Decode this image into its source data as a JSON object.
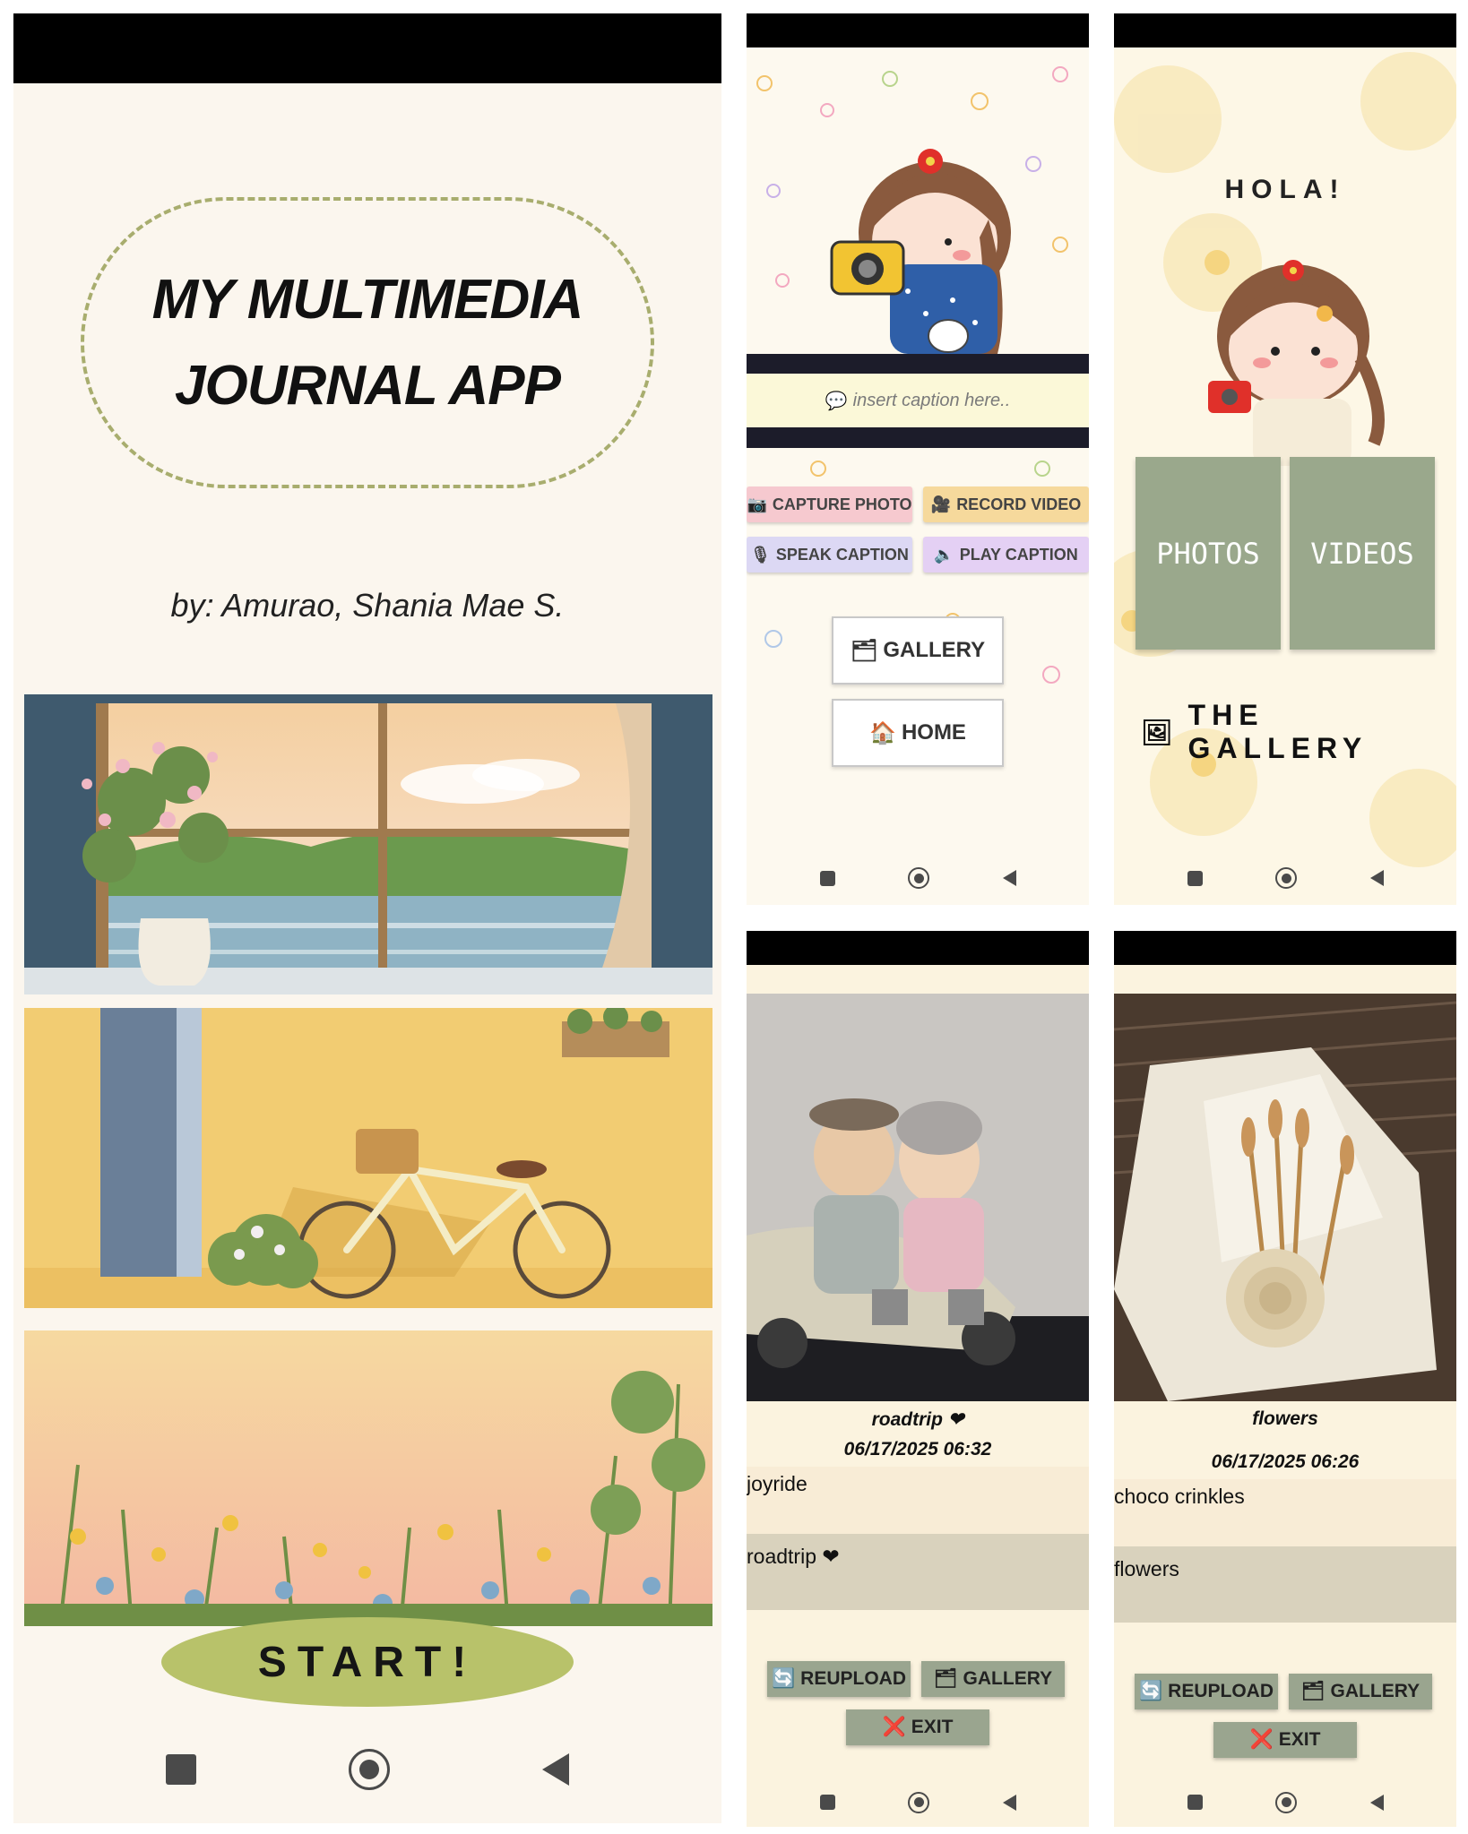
{
  "splash": {
    "title_line1": "MY MULTIMEDIA",
    "title_line2": "JOURNAL APP",
    "author": "by: Amurao, Shania Mae S.",
    "start_label": "START!"
  },
  "capture": {
    "caption_placeholder": "insert caption here..",
    "capture_photo_label": "CAPTURE PHOTO",
    "record_video_label": "RECORD VIDEO",
    "speak_caption_label": "SPEAK CAPTION",
    "play_caption_label": "PLAY CAPTION",
    "gallery_label": "GALLERY",
    "home_label": "HOME"
  },
  "gallery_home": {
    "greeting": "HOLA!",
    "photos_label": "PHOTOS",
    "videos_label": "VIDEOS",
    "heading": "THE GALLERY"
  },
  "entries": [
    {
      "title": "roadtrip ❤",
      "date": "06/17/2025 06:32",
      "field1": "joyride",
      "field2": "roadtrip ❤"
    },
    {
      "title": "flowers",
      "date": "06/17/2025 06:26",
      "field1": "choco crinkles",
      "field2": "flowers"
    }
  ],
  "detail_buttons": {
    "reupload_label": "REUPLOAD",
    "gallery_label": "GALLERY",
    "exit_label": "EXIT"
  },
  "colors": {
    "sage": "#9aa88c",
    "start_green": "#b8c26a",
    "cream": "#fbf6ee"
  }
}
